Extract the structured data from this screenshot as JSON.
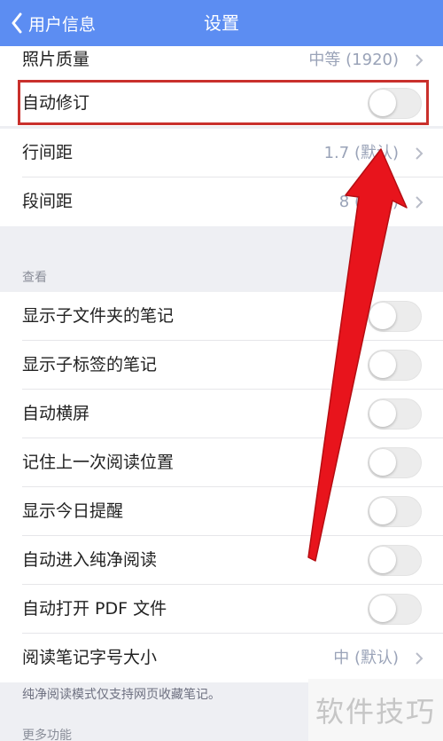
{
  "nav": {
    "back_label": "用户信息",
    "title": "设置"
  },
  "top_rows": [
    {
      "label": "照片质量",
      "value": "中等 (1920)",
      "control": "chevron"
    },
    {
      "label": "自动修订",
      "value": "",
      "control": "toggle",
      "on": false
    },
    {
      "label": "行间距",
      "value": "1.7 (默认)",
      "control": "chevron"
    },
    {
      "label": "段间距",
      "value": "8 (默认)",
      "control": "chevron"
    }
  ],
  "view_section": {
    "header": "查看",
    "rows": [
      {
        "label": "显示子文件夹的笔记",
        "control": "toggle",
        "on": false
      },
      {
        "label": "显示子标签的笔记",
        "control": "toggle",
        "on": false
      },
      {
        "label": "自动横屏",
        "control": "toggle",
        "on": false
      },
      {
        "label": "记住上一次阅读位置",
        "control": "toggle",
        "on": false
      },
      {
        "label": "显示今日提醒",
        "control": "toggle",
        "on": false
      },
      {
        "label": "自动进入纯净阅读",
        "control": "toggle",
        "on": false
      },
      {
        "label": "自动打开 PDF 文件",
        "control": "toggle",
        "on": false
      },
      {
        "label": "阅读笔记字号大小",
        "value": "中 (默认)",
        "control": "chevron"
      }
    ],
    "footnote": "纯净阅读模式仅支持网页收藏笔记。"
  },
  "more_section": {
    "header": "更多功能"
  },
  "watermark": "软件技巧",
  "colors": {
    "nav_bg": "#5c8df2",
    "highlight": "#c9302c",
    "arrow": "#e8141c"
  },
  "annotation_icon": "red-arrow-icon"
}
